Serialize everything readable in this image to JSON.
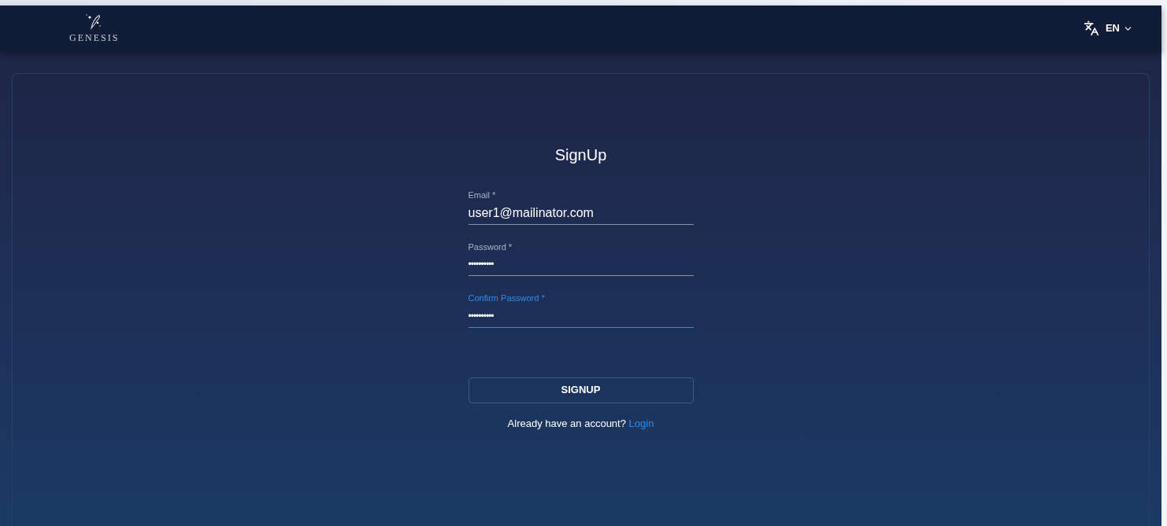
{
  "header": {
    "logo_text": "GENESIS",
    "language": "EN"
  },
  "form": {
    "title": "SignUp",
    "fields": [
      {
        "label": "Email *",
        "value": "user1@mailinator.com",
        "focused": false,
        "kind": "text"
      },
      {
        "label": "Password *",
        "value": "••••••••••",
        "focused": false,
        "kind": "password"
      },
      {
        "label": "Confirm Password *",
        "value": "••••••••••",
        "focused": true,
        "kind": "password"
      }
    ],
    "submit": "SIGNUP",
    "prompt": "Already have an account?",
    "link": "Login"
  }
}
